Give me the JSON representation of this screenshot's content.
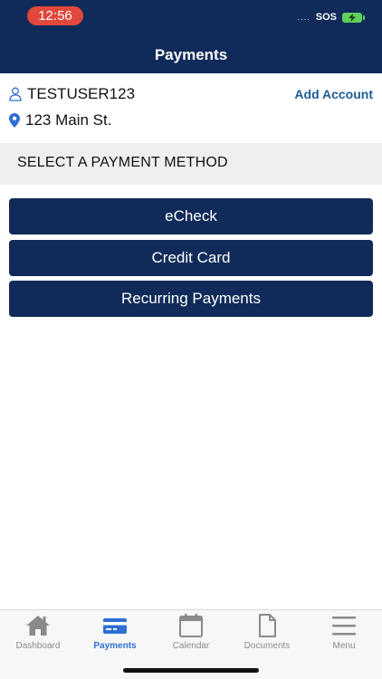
{
  "status_bar": {
    "time": "12:56",
    "signal": "....",
    "sos": "SOS"
  },
  "header": {
    "title": "Payments"
  },
  "account": {
    "username": "TESTUSER123",
    "address": "123 Main St.",
    "add_account_label": "Add Account"
  },
  "section": {
    "title": "SELECT A PAYMENT METHOD"
  },
  "payment_methods": [
    "eCheck",
    "Credit Card",
    "Recurring Payments"
  ],
  "tabs": [
    {
      "label": "Dashboard",
      "icon": "home-icon",
      "active": false
    },
    {
      "label": "Payments",
      "icon": "credit-card-icon",
      "active": true
    },
    {
      "label": "Calendar",
      "icon": "calendar-icon",
      "active": false
    },
    {
      "label": "Documents",
      "icon": "document-icon",
      "active": false
    },
    {
      "label": "Menu",
      "icon": "menu-icon",
      "active": false
    }
  ],
  "colors": {
    "navy": "#102b59",
    "accent_blue": "#2f6fd4",
    "link_blue": "#1f5d94",
    "status_red": "#e2473b",
    "battery_green": "#5fd15a",
    "section_gray": "#efefef",
    "tab_gray": "#8a8a8a"
  }
}
